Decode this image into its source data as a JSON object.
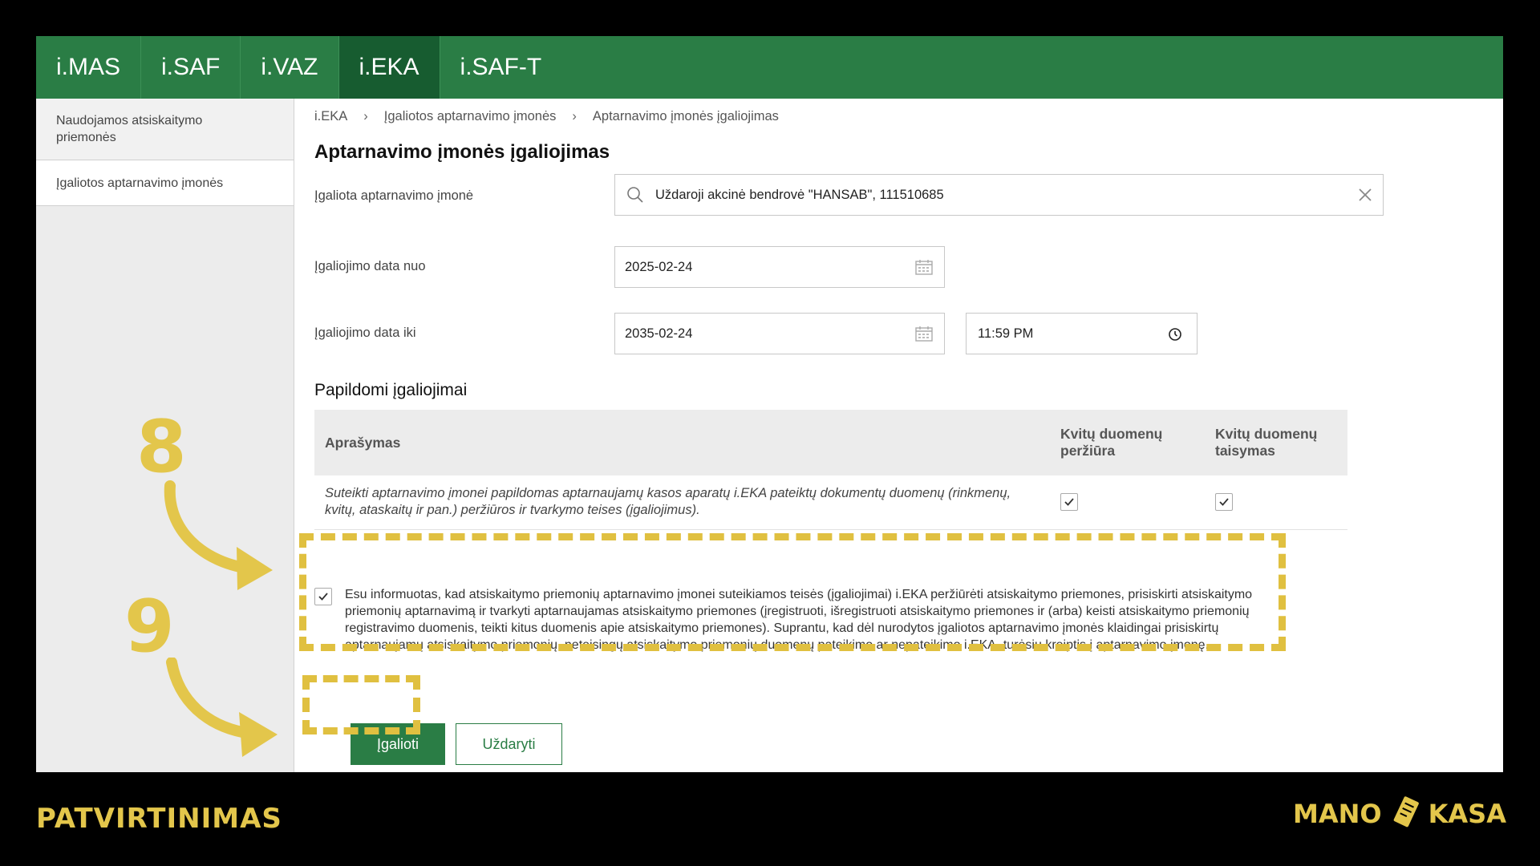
{
  "nav": {
    "tabs": [
      {
        "label": "i.MAS",
        "active": false
      },
      {
        "label": "i.SAF",
        "active": false
      },
      {
        "label": "i.VAZ",
        "active": false
      },
      {
        "label": "i.EKA",
        "active": true
      },
      {
        "label": "i.SAF-T",
        "active": false
      }
    ]
  },
  "sidebar": {
    "items": [
      {
        "label": "Naudojamos atsiskaitymo priemonės"
      },
      {
        "label": "Įgaliotos aptarnavimo įmonės"
      }
    ]
  },
  "breadcrumb": {
    "items": [
      "i.EKA",
      "Įgaliotos aptarnavimo įmonės",
      "Aptarnavimo įmonės įgaliojimas"
    ],
    "separator": "›"
  },
  "page": {
    "title": "Aptarnavimo įmonės įgaliojimas"
  },
  "form": {
    "company": {
      "label": "Įgaliota aptarnavimo įmonė",
      "value": "Uždaroji akcinė bendrovė \"HANSAB\", 111510685",
      "icon": "search-icon",
      "clear_icon": "close-icon"
    },
    "date_from": {
      "label": "Įgaliojimo data nuo",
      "value": "2025-02-24",
      "icon": "calendar-icon"
    },
    "date_to": {
      "label": "Įgaliojimo data iki",
      "value": "2035-02-24",
      "icon": "calendar-icon",
      "time": "11:59 PM",
      "time_icon": "clock-icon"
    }
  },
  "permissions": {
    "heading": "Papildomi įgaliojimai",
    "columns": [
      "Aprašymas",
      "Kvitų duomenų peržiūra",
      "Kvitų duomenų taisymas"
    ],
    "rows": [
      {
        "description": "Suteikti aptarnavimo įmonei papildomas aptarnaujamų kasos aparatų i.EKA pateiktų dokumentų duomenų (rinkmenų, kvitų, ataskaitų ir pan.) peržiūros ir tvarkymo teises (įgaliojimus).",
        "view_checked": true,
        "edit_checked": true
      }
    ]
  },
  "consent": {
    "checked": true,
    "text": "Esu informuotas, kad atsiskaitymo priemonių aptarnavimo įmonei suteikiamos teisės (įgaliojimai) i.EKA peržiūrėti atsiskaitymo priemones, prisiskirti atsiskaitymo priemonių aptarnavimą ir tvarkyti aptarnaujamas atsiskaitymo priemones (įregistruoti, išregistruoti atsiskaitymo priemones ir (arba) keisti atsiskaitymo priemonių registravimo duomenis, teikti kitus duomenis apie atsiskaitymo priemones). Suprantu, kad dėl nurodytos įgaliotos aptarnavimo įmonės klaidingai prisiskirtų aptarnaujamų atsiskaitymo priemonių, neteisingų atsiskaitymo priemonių duomenų pateikimo ar nepateikimo i.EKA, turėsiu kreiptis į aptarnavimo įmonę."
  },
  "actions": {
    "submit_label": "Įgalioti",
    "close_label": "Uždaryti"
  },
  "annotations": {
    "step_a": "8",
    "step_b": "9",
    "footer": "PATVIRTINIMAS",
    "logo_left": "MANO",
    "logo_right": "KASA",
    "accent_color": "#e3c64b",
    "brand_green": "#2a7d45"
  }
}
